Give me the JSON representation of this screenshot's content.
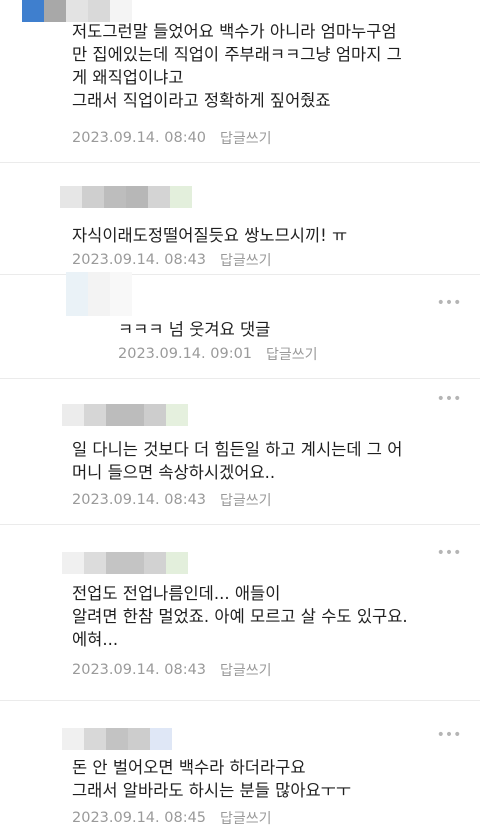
{
  "comments": [
    {
      "text": "저도그런말 들었어요 백수가 아니라 엄마누구엄\n만 집에있는데 직업이 주부래ㅋㅋ그냥 엄마지 그\n게 왜직업이냐고\n그래서 직업이라고 정확하게 짚어줬죠",
      "date": "2023.09.14. 08:40",
      "reply": "답글쓰기"
    },
    {
      "text": "자식이래도정떨어질듯요 쌍노므시끼! ㅠ",
      "date": "2023.09.14. 08:43",
      "reply": "답글쓰기"
    },
    {
      "text": "ㅋㅋㅋ 넘 웃겨요 댓글",
      "date": "2023.09.14. 09:01",
      "reply": "답글쓰기"
    },
    {
      "text": "일 다니는 것보다 더 힘든일 하고 계시는데 그 어\n머니 들으면 속상하시겠어요..",
      "date": "2023.09.14. 08:43",
      "reply": "답글쓰기"
    },
    {
      "text": "전업도 전업나름인데... 애들이\n알려면 한참 멀었죠. 아예 모르고 살 수도 있구요.\n에혀...",
      "date": "2023.09.14. 08:43",
      "reply": "답글쓰기"
    },
    {
      "text": "돈 안 벌어오면 백수라 하더라구요\n그래서 알바라도 하시는 분들 많아요ㅜㅜ",
      "date": "2023.09.14. 08:45",
      "reply": "답글쓰기"
    }
  ],
  "more_label": "•••"
}
